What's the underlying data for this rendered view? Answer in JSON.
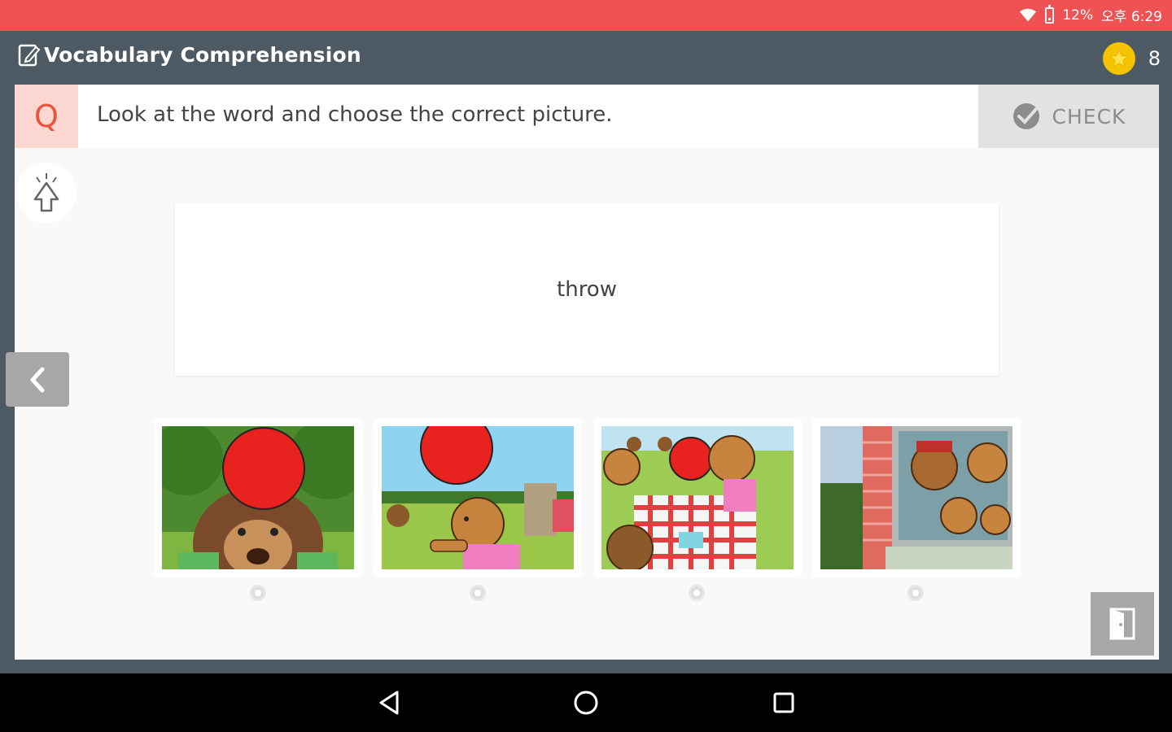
{
  "status_bar": {
    "battery": "12%",
    "time": "오후 6:29"
  },
  "header": {
    "title": "Vocabulary Comprehension",
    "coins": "8"
  },
  "question": {
    "badge": "Q",
    "text": "Look at the word and choose the correct picture.",
    "check_label": "CHECK"
  },
  "word": "throw",
  "choices": [
    {
      "icon": "bear-under-ball-picture"
    },
    {
      "icon": "bear-throwing-ball-picture"
    },
    {
      "icon": "bears-picnic-ball-picture"
    },
    {
      "icon": "bears-at-window-picture"
    }
  ],
  "colors": {
    "status_bar": "#ee5253",
    "header": "#4e5a63",
    "accent": "#e8543f",
    "coin": "#f5c400"
  }
}
